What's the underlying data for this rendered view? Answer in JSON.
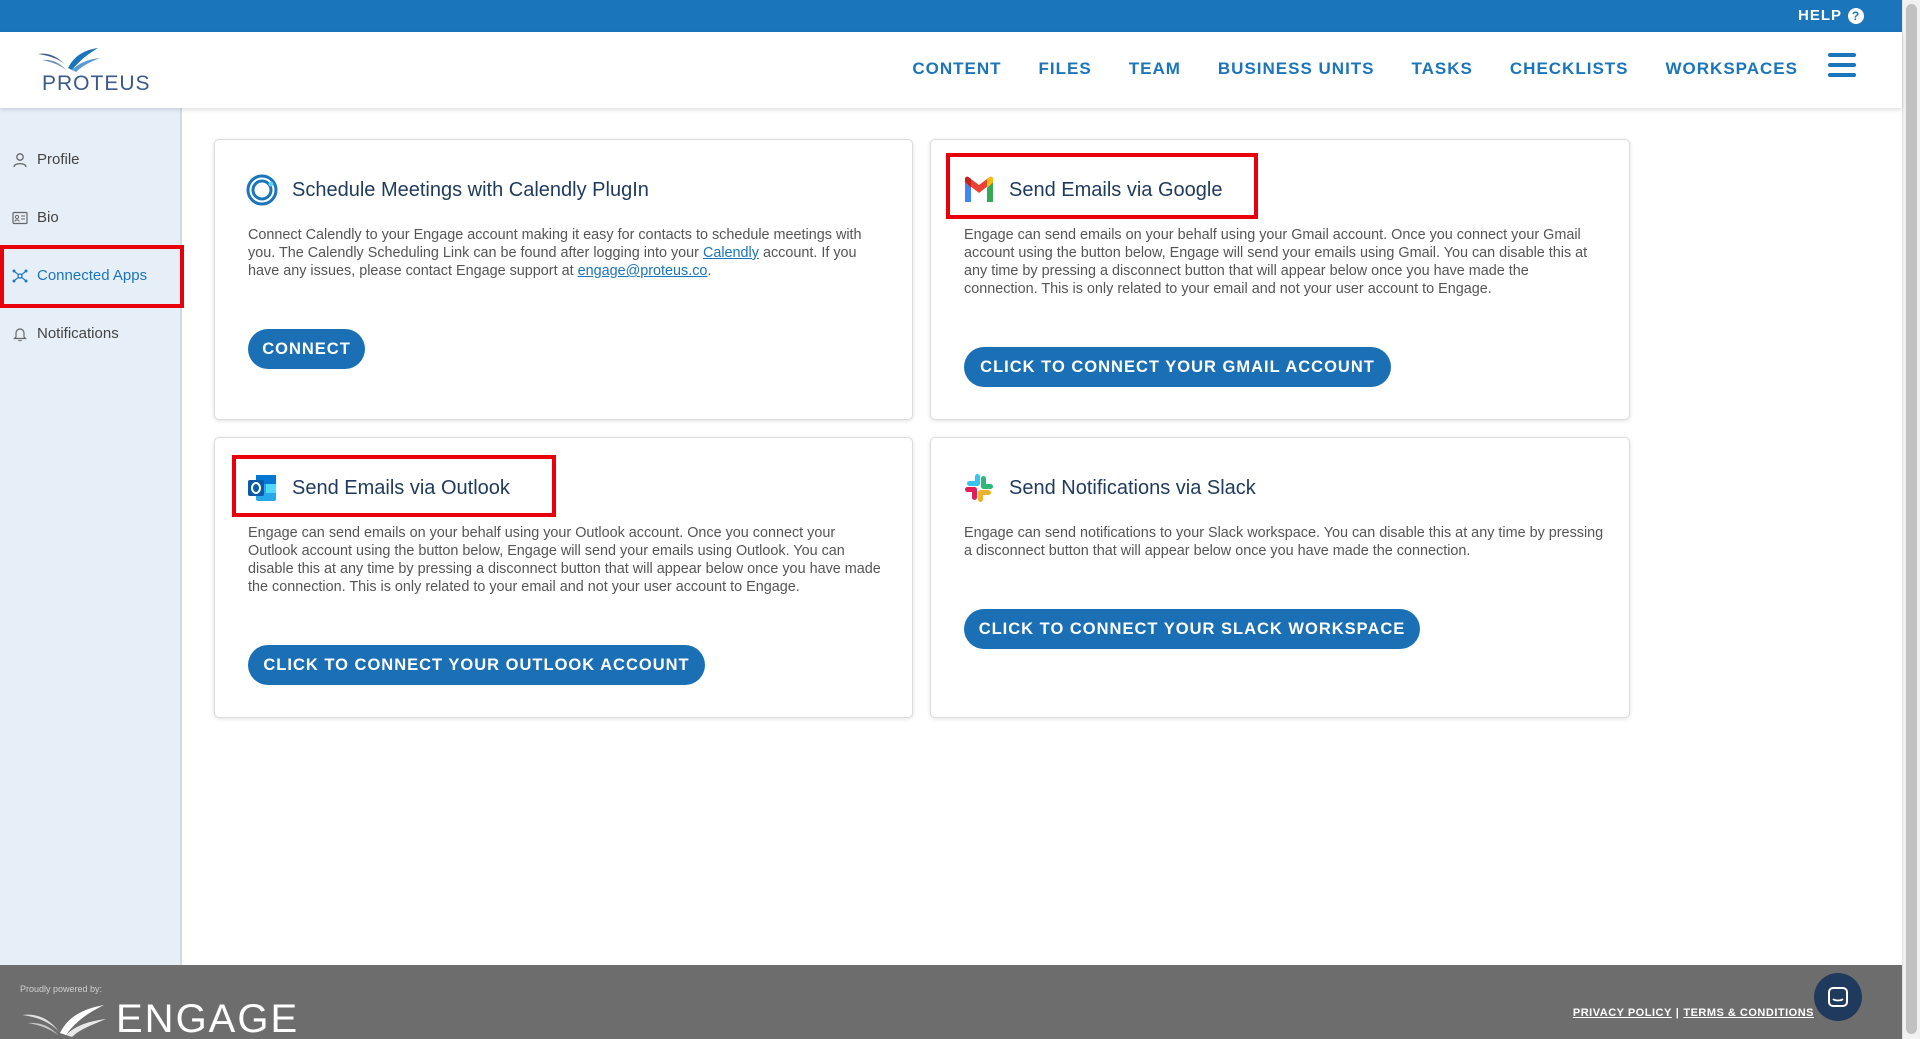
{
  "topbar": {
    "help_label": "HELP",
    "help_icon": "?"
  },
  "header": {
    "logo_text": "PROTEUS",
    "nav": [
      "CONTENT",
      "FILES",
      "TEAM",
      "BUSINESS UNITS",
      "TASKS",
      "CHECKLISTS",
      "WORKSPACES"
    ]
  },
  "sidebar": {
    "items": [
      {
        "label": "Profile",
        "icon": "user-icon"
      },
      {
        "label": "Bio",
        "icon": "id-card-icon"
      },
      {
        "label": "Connected Apps",
        "icon": "network-icon",
        "active": true
      },
      {
        "label": "Notifications",
        "icon": "bell-icon"
      }
    ]
  },
  "cards": {
    "calendly": {
      "title": "Schedule Meetings with Calendly PlugIn",
      "body_1": "Connect Calendly to your Engage account making it easy for contacts to schedule meetings with you. The Calendly Scheduling Link can be found after logging into your",
      "link_1": "Calendly",
      "body_2": " account. If you have any issues, please contact Engage support at ",
      "link_2": "engage@proteus.co",
      "body_3": ".",
      "button": "CONNECT"
    },
    "google": {
      "title": "Send Emails via Google",
      "body": "Engage can send emails on your behalf using your Gmail account. Once you connect your Gmail account using the button below, Engage will send your emails using Gmail. You can disable this at any time by pressing a disconnect button that will appear below once you have made the connection. This is only related to your email and not your user account to Engage.",
      "button": "CLICK TO CONNECT YOUR GMAIL ACCOUNT"
    },
    "outlook": {
      "title": "Send Emails via Outlook",
      "body": "Engage can send emails on your behalf using your Outlook account. Once you connect your Outlook account using the button below, Engage will send your emails using Outlook. You can disable this at any time by pressing a disconnect button that will appear below once you have made the connection. This is only related to your email and not your user account to Engage.",
      "button": "CLICK TO CONNECT YOUR OUTLOOK ACCOUNT"
    },
    "slack": {
      "title": "Send Notifications via Slack",
      "body": "Engage can send notifications to your Slack workspace. You can disable this at any time by pressing a disconnect button that will appear below once you have made the connection.",
      "button": "CLICK TO CONNECT YOUR SLACK WORKSPACE"
    }
  },
  "footer": {
    "powered_by": "Proudly powered by:",
    "brand": "ENGAGE",
    "privacy": "PRIVACY POLICY",
    "separator": "|",
    "terms": "TERMS & CONDITIONS"
  },
  "colors": {
    "primary": "#1b75bb",
    "button": "#1b6fb5",
    "highlight": "#e8000b",
    "sidebar_bg": "#e6eef8",
    "footer_bg": "#6d6d6d"
  }
}
